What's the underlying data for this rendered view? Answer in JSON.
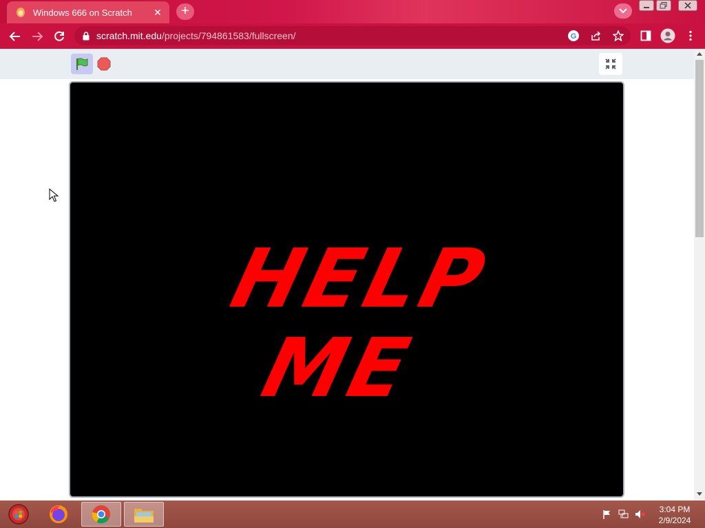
{
  "browser": {
    "tab": {
      "title": "Windows 666 on Scratch",
      "favicon": "scratch-cat-icon"
    },
    "url": {
      "host": "scratch.mit.edu",
      "path": "/projects/794861583/fullscreen/"
    },
    "colors": {
      "theme": "#c9123f",
      "tab_active": "#e2445f"
    }
  },
  "player": {
    "stage_text": "HELP ME",
    "colors": {
      "stage_bg": "#000000",
      "text": "#ff0000",
      "controls_bg": "#e9eef2"
    }
  },
  "taskbar": {
    "apps": [
      "firefox-icon",
      "chrome-icon",
      "file-explorer-icon"
    ],
    "clock": {
      "time": "3:04 PM",
      "date": "2/9/2024"
    }
  }
}
